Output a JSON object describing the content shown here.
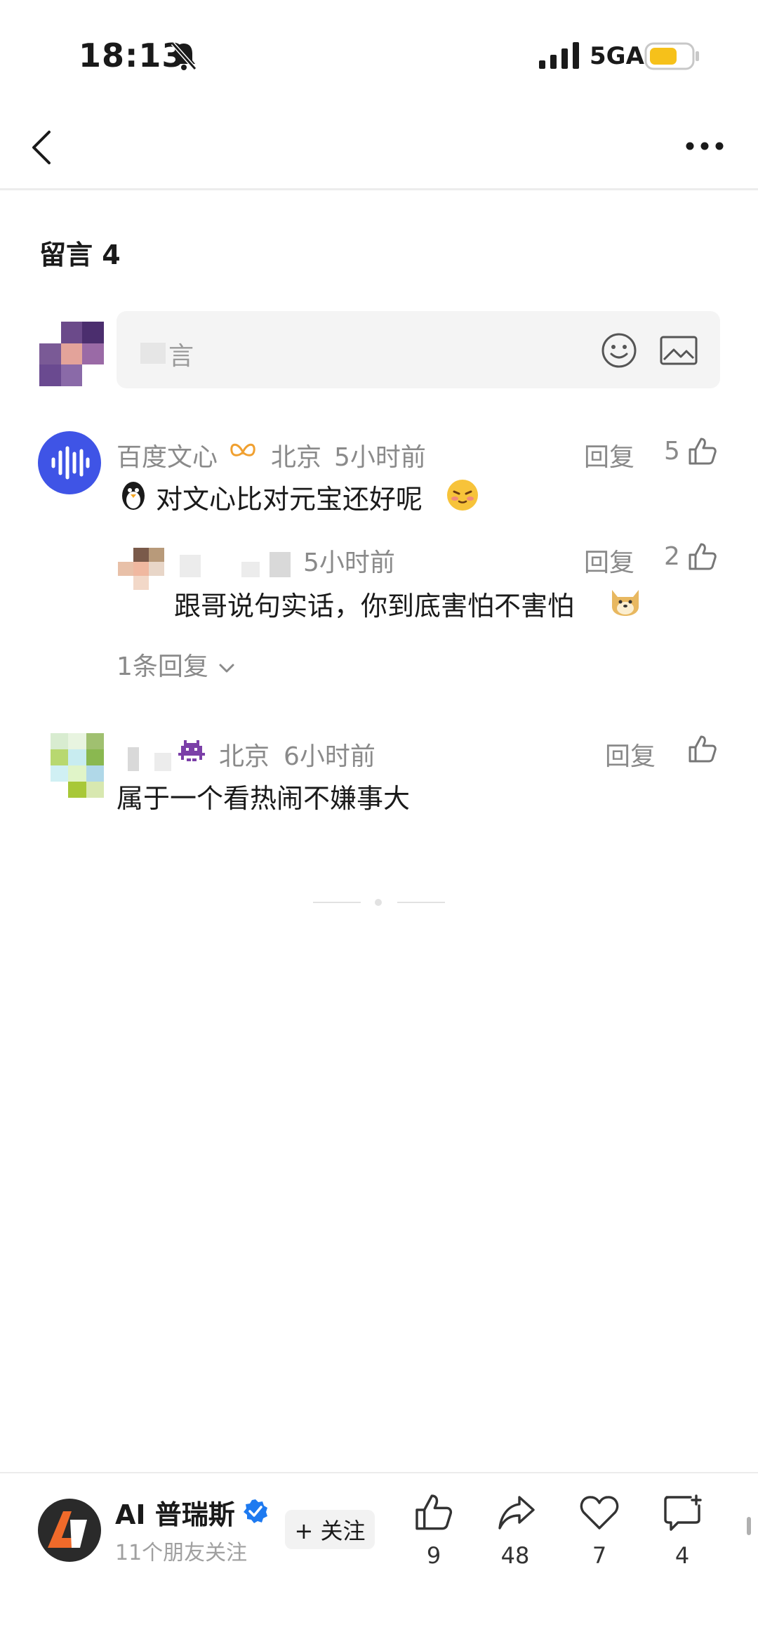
{
  "status_bar": {
    "time": "18:13",
    "network": "5GA"
  },
  "comments": {
    "title": "留言 4",
    "input_placeholder": "言",
    "items": [
      {
        "author": "百度文心",
        "location": "北京",
        "time": "5小时前",
        "reply_label": "回复",
        "likes": "5",
        "text": "对文心比对元宝还好呢",
        "replies": [
          {
            "time": "5小时前",
            "reply_label": "回复",
            "likes": "2",
            "text": "跟哥说句实话，你到底害怕不害怕"
          }
        ],
        "more_replies": "1条回复"
      },
      {
        "location": "北京",
        "time": "6小时前",
        "reply_label": "回复",
        "text": "属于一个看热闹不嫌事大"
      }
    ]
  },
  "bottom_bar": {
    "account_name": "AI 普瑞斯",
    "followers": "11个朋友关注",
    "follow_label": "+ 关注",
    "likes": "9",
    "shares": "48",
    "favorites": "7",
    "comments": "4"
  }
}
